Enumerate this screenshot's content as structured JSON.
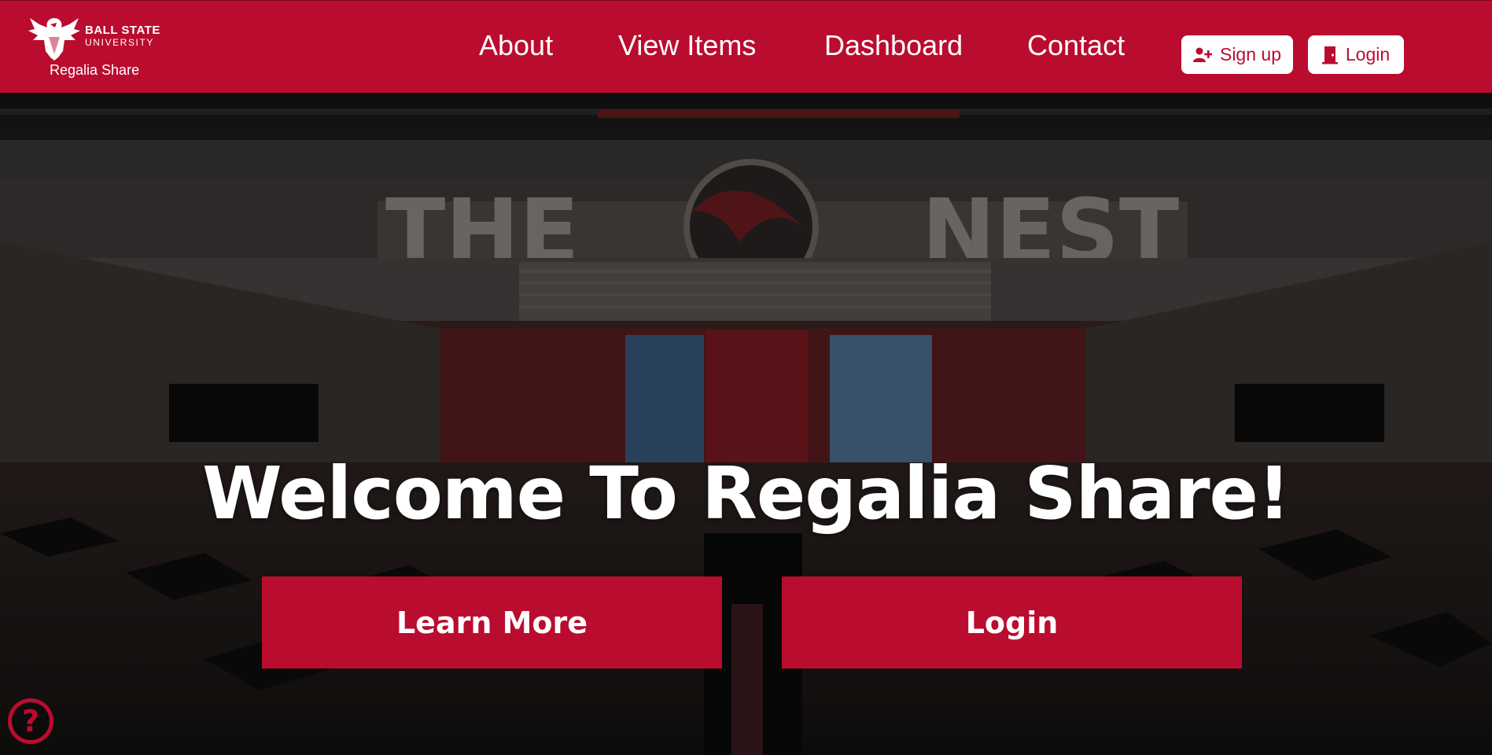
{
  "brand": {
    "university_line1": "BALL STATE",
    "university_line2": "UNIVERSITY",
    "app_name": "Regalia Share"
  },
  "nav": {
    "links": [
      "About",
      "View Items",
      "Dashboard",
      "Contact"
    ],
    "signup_label": "Sign up",
    "login_label": "Login"
  },
  "hero": {
    "banner_text_left": "THE",
    "banner_text_right": "NEST",
    "title": "Welcome To Regalia Share!",
    "learn_more_label": "Learn More",
    "login_label": "Login",
    "help_label": "?"
  },
  "colors": {
    "brand_red": "#ba0c2f",
    "white": "#ffffff"
  },
  "icons": {
    "signup": "user-plus-icon",
    "login": "door-icon",
    "help": "question-circle-icon"
  }
}
